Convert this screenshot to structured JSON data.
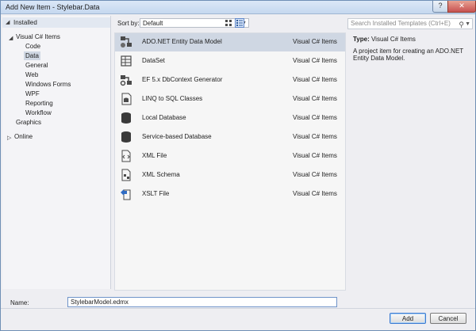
{
  "window": {
    "title": "Add New Item - Stylebar.Data",
    "help_label": "?",
    "close_label": "✕"
  },
  "tree": {
    "installed": "Installed",
    "group": "Visual C# Items",
    "children": [
      "Code",
      "Data",
      "General",
      "Web",
      "Windows Forms",
      "WPF",
      "Reporting",
      "Workflow"
    ],
    "graphics": "Graphics",
    "online": "Online"
  },
  "toolbar": {
    "sort_label": "Sort by:",
    "sort_value": "Default"
  },
  "search": {
    "placeholder": "Search Installed Templates (Ctrl+E)"
  },
  "items": [
    {
      "name": "ADO.NET Entity Data Model",
      "type": "Visual C# Items",
      "icon": "entity-model-icon",
      "selected": true
    },
    {
      "name": "DataSet",
      "type": "Visual C# Items",
      "icon": "dataset-icon"
    },
    {
      "name": "EF 5.x DbContext Generator",
      "type": "Visual C# Items",
      "icon": "ef-generator-icon"
    },
    {
      "name": "LINQ to SQL Classes",
      "type": "Visual C# Items",
      "icon": "linq-icon"
    },
    {
      "name": "Local Database",
      "type": "Visual C# Items",
      "icon": "database-icon"
    },
    {
      "name": "Service-based Database",
      "type": "Visual C# Items",
      "icon": "database-icon"
    },
    {
      "name": "XML File",
      "type": "Visual C# Items",
      "icon": "xml-file-icon"
    },
    {
      "name": "XML Schema",
      "type": "Visual C# Items",
      "icon": "xml-schema-icon"
    },
    {
      "name": "XSLT File",
      "type": "Visual C# Items",
      "icon": "xslt-file-icon"
    }
  ],
  "details": {
    "type_label": "Type:",
    "type_value": "Visual C# Items",
    "description": "A project item for creating an ADO.NET Entity Data Model."
  },
  "name_field": {
    "label": "Name:",
    "value": "StylebarModel.edmx"
  },
  "buttons": {
    "add": "Add",
    "cancel": "Cancel"
  },
  "colors": {
    "selection": "#cfd7e3",
    "accent": "#3d7bd1"
  }
}
